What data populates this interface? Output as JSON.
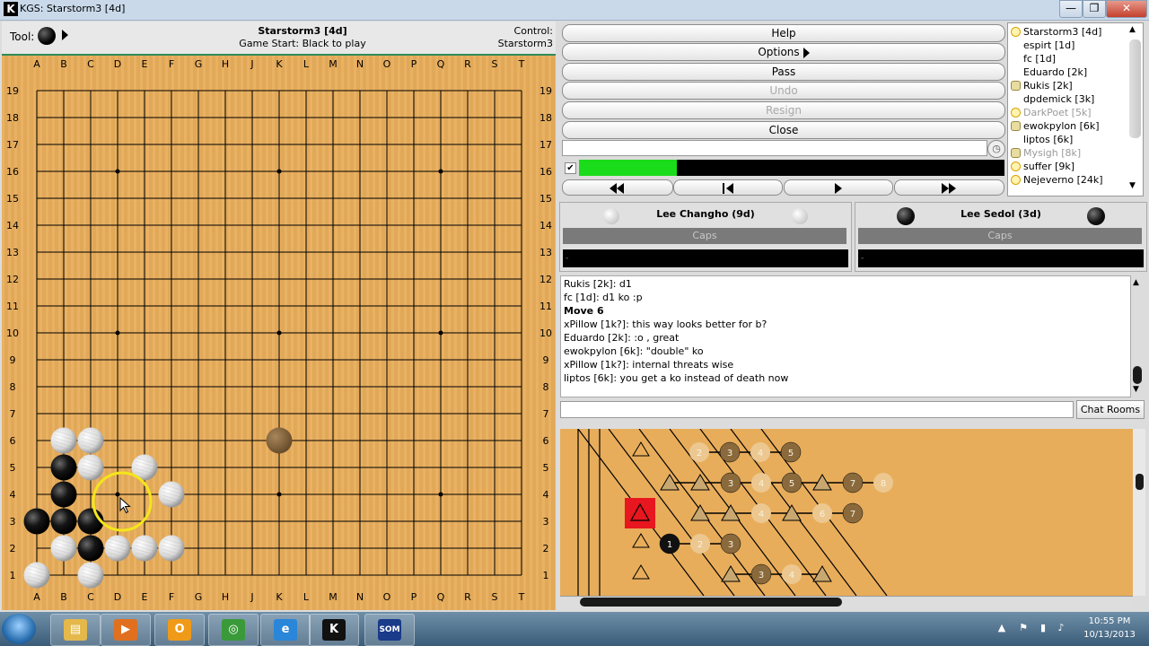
{
  "window": {
    "title": "KGS: Starstorm3 [4d]",
    "k_icon": "K",
    "minimize": "—",
    "maximize": "❐",
    "close": "✕"
  },
  "info": {
    "tool_label": "Tool:",
    "game_title": "Starstorm3 [4d]",
    "status": "Game Start: Black to play",
    "control_label": "Control:",
    "control_value": "Starstorm3"
  },
  "board": {
    "columns": [
      "A",
      "B",
      "C",
      "D",
      "E",
      "F",
      "G",
      "H",
      "J",
      "K",
      "L",
      "M",
      "N",
      "O",
      "P",
      "Q",
      "R",
      "S",
      "T"
    ],
    "rows": [
      "19",
      "18",
      "17",
      "16",
      "15",
      "14",
      "13",
      "12",
      "11",
      "10",
      "9",
      "8",
      "7",
      "6",
      "5",
      "4",
      "3",
      "2",
      "1"
    ],
    "hoshi": [
      "D16",
      "K16",
      "Q16",
      "D10",
      "K10",
      "Q10",
      "D4",
      "K4",
      "Q4"
    ],
    "stones": [
      {
        "pos": "B6",
        "color": "white"
      },
      {
        "pos": "C6",
        "color": "white"
      },
      {
        "pos": "B5",
        "color": "black"
      },
      {
        "pos": "C5",
        "color": "white"
      },
      {
        "pos": "E5",
        "color": "white"
      },
      {
        "pos": "B4",
        "color": "black"
      },
      {
        "pos": "F4",
        "color": "white"
      },
      {
        "pos": "A3",
        "color": "black"
      },
      {
        "pos": "B3",
        "color": "black"
      },
      {
        "pos": "C3",
        "color": "black"
      },
      {
        "pos": "B2",
        "color": "white"
      },
      {
        "pos": "C2",
        "color": "black"
      },
      {
        "pos": "D2",
        "color": "white"
      },
      {
        "pos": "E2",
        "color": "white"
      },
      {
        "pos": "F2",
        "color": "white"
      },
      {
        "pos": "A1",
        "color": "white"
      },
      {
        "pos": "C1",
        "color": "white"
      },
      {
        "pos": "K6",
        "color": "ghost"
      }
    ],
    "highlight": "D4",
    "colors": {
      "wood": "#e8ad5b",
      "line": "#000000",
      "highlight": "#f4e61a"
    }
  },
  "controls": {
    "help": "Help",
    "options": "Options",
    "pass": "Pass",
    "undo": "Undo",
    "resign": "Resign",
    "close": "Close",
    "checkbox": "✔",
    "clock_icon": "clock-icon"
  },
  "progress": {
    "fraction": 0.23,
    "color": "#1bdc1b"
  },
  "users": [
    {
      "name": "Starstorm3 [4d]",
      "icon": "crown",
      "grey": false
    },
    {
      "name": "espirt [1d]",
      "icon": "",
      "grey": false
    },
    {
      "name": "fc [1d]",
      "icon": "",
      "grey": false
    },
    {
      "name": "Eduardo [2k]",
      "icon": "",
      "grey": false
    },
    {
      "name": "Rukis [2k]",
      "icon": "eye",
      "grey": false
    },
    {
      "name": "dpdemick [3k]",
      "icon": "",
      "grey": false
    },
    {
      "name": "DarkPoet [5k]",
      "icon": "crown",
      "grey": true
    },
    {
      "name": "ewokpylon [6k]",
      "icon": "eye",
      "grey": false
    },
    {
      "name": "liptos [6k]",
      "icon": "",
      "grey": false
    },
    {
      "name": "Mysigh [8k]",
      "icon": "eye",
      "grey": true
    },
    {
      "name": "suffer [9k]",
      "icon": "crown",
      "grey": false
    },
    {
      "name": "Nejeverno [24k]",
      "icon": "crown",
      "grey": false
    }
  ],
  "players": {
    "white": {
      "name": "Lee Changho (9d)",
      "caps": "Caps",
      "time": "-"
    },
    "black": {
      "name": "Lee Sedol (3d)",
      "caps": "Caps",
      "time": "-"
    }
  },
  "chat": [
    {
      "text": "Rukis [2k]: d1",
      "bold": false
    },
    {
      "text": "fc [1d]: d1 ko :p",
      "bold": false
    },
    {
      "text": "Move 6",
      "bold": true
    },
    {
      "text": "xPillow [1k?]: this way looks better for b?",
      "bold": false
    },
    {
      "text": "Eduardo [2k]: :o , great",
      "bold": false
    },
    {
      "text": "ewokpylon [6k]: \"double\" ko",
      "bold": false
    },
    {
      "text": "xPillow [1k?]: internal threats wise",
      "bold": false
    },
    {
      "text": "liptos [6k]: you get a ko instead of death now",
      "bold": false
    }
  ],
  "chat_rooms": "Chat Rooms",
  "tree": {
    "nodes": [
      {
        "label": "2",
        "kind": "ghost-w"
      },
      {
        "label": "3",
        "kind": "ghost-b"
      },
      {
        "label": "4",
        "kind": "ghost-w"
      },
      {
        "label": "5",
        "kind": "ghost-b"
      },
      {
        "label": "",
        "kind": "tri"
      },
      {
        "label": "",
        "kind": "tri"
      },
      {
        "label": "3",
        "kind": "ghost-b"
      },
      {
        "label": "4",
        "kind": "ghost-w"
      },
      {
        "label": "5",
        "kind": "ghost-b"
      },
      {
        "label": "",
        "kind": "tri"
      },
      {
        "label": "7",
        "kind": "ghost-b"
      },
      {
        "label": "8",
        "kind": "ghost-w"
      },
      {
        "label": "",
        "kind": "tri"
      },
      {
        "label": "",
        "kind": "tri"
      },
      {
        "label": "4",
        "kind": "ghost-w"
      },
      {
        "label": "",
        "kind": "tri"
      },
      {
        "label": "6",
        "kind": "ghost-w"
      },
      {
        "label": "7",
        "kind": "ghost-b"
      },
      {
        "label": "1",
        "kind": "black"
      },
      {
        "label": "2",
        "kind": "ghost-w"
      },
      {
        "label": "3",
        "kind": "ghost-b"
      },
      {
        "label": "",
        "kind": "tri"
      },
      {
        "label": "3",
        "kind": "ghost-b"
      },
      {
        "label": "4",
        "kind": "ghost-w"
      },
      {
        "label": "",
        "kind": "tri"
      }
    ],
    "current_marker_color": "#e8161e"
  },
  "taskbar": {
    "time": "10:55 PM",
    "date": "10/13/2013",
    "apps": [
      {
        "name": "file-explorer-icon",
        "glyph": "▤",
        "color": "#e4b84a"
      },
      {
        "name": "media-player-icon",
        "glyph": "▶",
        "color": "#e07020"
      },
      {
        "name": "outlook-icon",
        "glyph": "O",
        "color": "#f09a1a"
      },
      {
        "name": "chrome-icon",
        "glyph": "◎",
        "color": "#3a9a3a"
      },
      {
        "name": "internet-explorer-icon",
        "glyph": "e",
        "color": "#2a86d8"
      },
      {
        "name": "kgs-icon",
        "glyph": "K",
        "color": "#111111"
      },
      {
        "name": "som-icon",
        "glyph": "SOM",
        "color": "#1a3a8a"
      }
    ]
  }
}
